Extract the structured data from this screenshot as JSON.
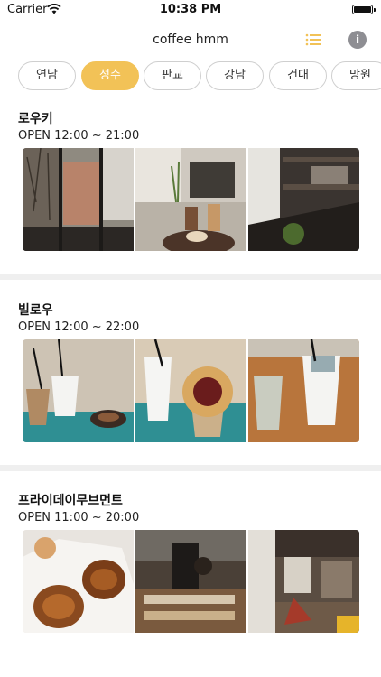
{
  "status_bar": {
    "carrier": "Carrier",
    "time": "10:38 PM"
  },
  "nav": {
    "title": "coffee hmm",
    "list_icon": "list-icon",
    "info_icon": "info-icon",
    "accent_color": "#f2c257"
  },
  "tabs": [
    {
      "label": "연남",
      "selected": false
    },
    {
      "label": "성수",
      "selected": true
    },
    {
      "label": "판교",
      "selected": false
    },
    {
      "label": "강남",
      "selected": false
    },
    {
      "label": "건대",
      "selected": false
    },
    {
      "label": "망원",
      "selected": false
    }
  ],
  "cafes": [
    {
      "name": "로우키",
      "hours": "OPEN 12:00 ~ 21:00"
    },
    {
      "name": "빌로우",
      "hours": "OPEN 12:00 ~ 22:00"
    },
    {
      "name": "프라이데이무브먼트",
      "hours": "OPEN 11:00 ~ 20:00"
    }
  ]
}
